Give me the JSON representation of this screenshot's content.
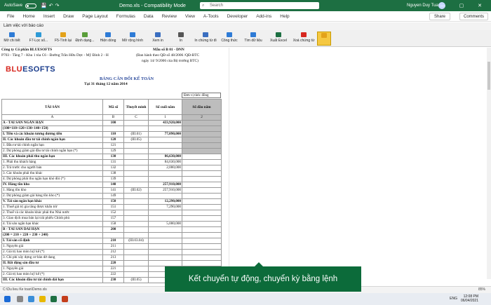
{
  "titlebar": {
    "autosave": "AutoSave",
    "toggle": "Off",
    "filename": "Demo.xls - Compatibility Mode",
    "search": "Search",
    "user": "Nguyen Duy Tuan",
    "winbtns": "— ▢ ✕"
  },
  "menu": [
    "File",
    "Home",
    "Insert",
    "Draw",
    "Page Layout",
    "Formulas",
    "Data",
    "Review",
    "View",
    "A-Tools",
    "Developer",
    "Add-ins",
    "Help"
  ],
  "share": "Share",
  "comments": "Comments",
  "addin_label": "Làm việc với báo cáo",
  "toolbar": [
    {
      "label": "Mở chi tiết",
      "color": "#2e7bd6"
    },
    {
      "label": "F7-Lọc số...",
      "color": "#2e9ad6"
    },
    {
      "label": "F5-Tính lại",
      "color": "#e3a21a"
    },
    {
      "label": "Định dạng...",
      "color": "#5a9e3a"
    },
    {
      "label": "Hiện dòng",
      "color": "#2e7bd6"
    },
    {
      "label": "Mở rộng hình",
      "color": "#2e7bd6"
    },
    {
      "label": "Xem in",
      "color": "#3a6ec0"
    },
    {
      "label": "In",
      "color": "#555555"
    },
    {
      "label": "In chứng từ đi",
      "color": "#3a6ec0"
    },
    {
      "label": "Công thức",
      "color": "#2e7bd6"
    },
    {
      "label": "Tìm dữ liệu",
      "color": "#2e7bd6"
    },
    {
      "label": "Xuất Excel",
      "color": "#1d6f42"
    },
    {
      "label": "Xoá chứng từ",
      "color": "#d7261e"
    },
    {
      "label": "",
      "color": "#e3a21a"
    }
  ],
  "doc": {
    "company": "Công ty Cổ phần BLUESOFTS",
    "address": "P703 - Tầng 7 - Khu 1 tòa C6 - Đường Trần Hữu Dực - Mỹ Đình 2 - H",
    "form": "Mẫu số B 01 - DNN",
    "form_note": "(Ban hành theo QĐ số  48/2006 /QĐ-BTC",
    "form_date": "ngày  14/ 9/2006 của Bộ trưởng BTC)",
    "logo_a": "BLU",
    "logo_b": "ESOFTS",
    "title": "BẢNG CÂN ĐỐI KẾ TOÁN",
    "date": "Tại 31 tháng 12 năm 2014",
    "unit": "Đơn vị tính: đồng",
    "headers": [
      "TÀI SẢN",
      "Mã số",
      "Thuyết minh",
      "Số cuối năm",
      "Số đầu năm"
    ],
    "header_codes": [
      "A",
      "B",
      "C",
      "1",
      "2"
    ]
  },
  "rows": [
    {
      "name": "A - TÀI SẢN NGẮN HẠN",
      "code": "100",
      "note": "",
      "end": "433,920,000",
      "bold": true
    },
    {
      "name": "(100=110+120+130+140+150)",
      "code": "",
      "note": "",
      "end": "",
      "bold": true
    },
    {
      "name": "I. Tiền và các khoản tương đương tiền",
      "code": "110",
      "note": "(III.01)",
      "end": "77,090,000",
      "bold": true
    },
    {
      "name": "II. Các khoản đầu tư tài chính ngắn hạn",
      "code": "120",
      "note": "(III.05)",
      "end": "",
      "bold": true
    },
    {
      "name": "1. Đầu tư tài chính ngắn hạn",
      "code": "121",
      "note": "",
      "end": "",
      "bold": false
    },
    {
      "name": "2. Dự phòng giảm giá đầu tư tài chính ngắn hạn (*)",
      "code": "129",
      "note": "",
      "end": "",
      "bold": false
    },
    {
      "name": "III. Các khoản phải thu ngắn hạn",
      "code": "130",
      "note": "",
      "end": "86,630,000",
      "bold": true
    },
    {
      "name": "1. Phải thu khách hàng",
      "code": "131",
      "note": "",
      "end": "84,630,000",
      "bold": false
    },
    {
      "name": "2. Trả trước cho người bán",
      "code": "132",
      "note": "",
      "end": "2,000,000",
      "bold": false
    },
    {
      "name": "3. Các khoản phải thu khác",
      "code": "138",
      "note": "",
      "end": "",
      "bold": false
    },
    {
      "name": "4. Dự phòng phải thu ngắn hạn khó đòi (*)",
      "code": "139",
      "note": "",
      "end": "",
      "bold": false
    },
    {
      "name": "IV. Hàng tồn kho",
      "code": "140",
      "note": "",
      "end": "257,910,000",
      "bold": true
    },
    {
      "name": "1. Hàng tồn kho",
      "code": "141",
      "note": "(III.02)",
      "end": "257,910,000",
      "bold": false
    },
    {
      "name": "2. Dự phòng giảm giá hàng tồn kho (*)",
      "code": "149",
      "note": "",
      "end": "",
      "bold": false
    },
    {
      "name": "V. Tài sản ngắn hạn khác",
      "code": "150",
      "note": "",
      "end": "12,290,000",
      "bold": true
    },
    {
      "name": "1. Thuế giá trị gia tăng được khấu trừ",
      "code": "151",
      "note": "",
      "end": "7,290,000",
      "bold": false
    },
    {
      "name": "2. Thuế và các khoản khác phải thu Nhà nước",
      "code": "152",
      "note": "",
      "end": "",
      "bold": false
    },
    {
      "name": "3. Giao dịch mua bán lại trái phiếu Chính phủ",
      "code": "157",
      "note": "",
      "end": "",
      "bold": false
    },
    {
      "name": "4. Tài sản ngắn hạn khác",
      "code": "158",
      "note": "",
      "end": "5,000,000",
      "bold": false
    },
    {
      "name": "B - TÀI SẢN DÀI HẠN",
      "code": "200",
      "note": "",
      "end": "",
      "bold": true
    },
    {
      "name": "(200 = 210 + 220 + 230 + 240)",
      "code": "",
      "note": "",
      "end": "",
      "bold": true
    },
    {
      "name": "I. Tài sản cố định",
      "code": "210",
      "note": "(III.03.04)",
      "end": "",
      "bold": true
    },
    {
      "name": "1. Nguyên giá",
      "code": "211",
      "note": "",
      "end": "",
      "bold": false
    },
    {
      "name": "2. Giá trị hao mòn luỹ kế (*)",
      "code": "212",
      "note": "",
      "end": "",
      "bold": false
    },
    {
      "name": "3. Chi phí xây dựng cơ bản dở dang",
      "code": "213",
      "note": "",
      "end": "",
      "bold": false
    },
    {
      "name": "II. Bất động sản đầu tư",
      "code": "220",
      "note": "",
      "end": "",
      "bold": true
    },
    {
      "name": "1. Nguyên giá",
      "code": "221",
      "note": "",
      "end": "",
      "bold": false
    },
    {
      "name": "2. Giá trị hao mòn luỹ kế (*)",
      "code": "222",
      "note": "",
      "end": "",
      "bold": false
    },
    {
      "name": "III. Các khoản đầu tư tài chính dài hạn",
      "code": "230",
      "note": "(III.05)",
      "end": "",
      "bold": true
    }
  ],
  "statusbar": {
    "path": "C:\\Du lieu Ke toan\\Demo.xls",
    "zoom": "85%"
  },
  "taskbar": {
    "lang": "ENG",
    "time": "12:08 PM",
    "date": "06/04/2021"
  },
  "banner": "Kết chuyển tự động, chuyển kỳ bằng lệnh"
}
